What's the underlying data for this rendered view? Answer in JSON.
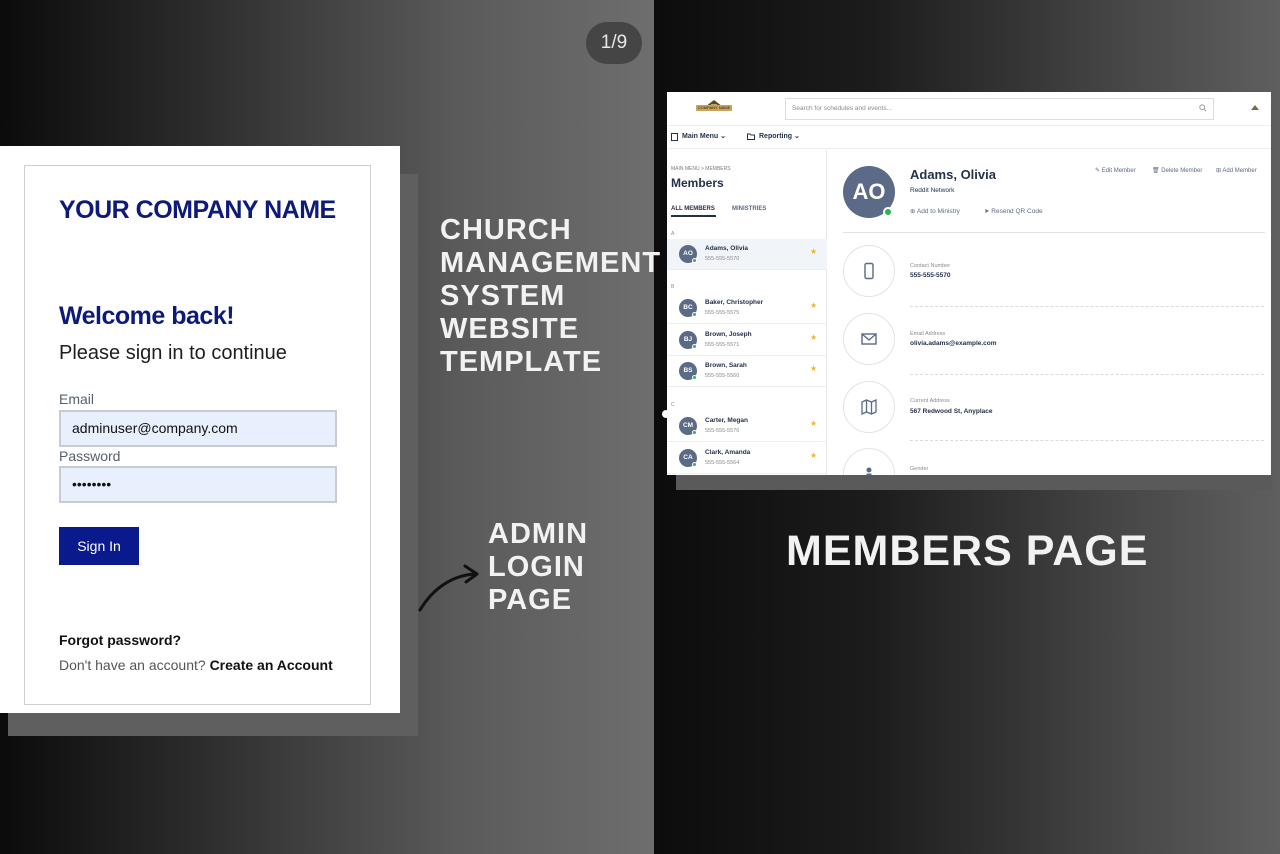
{
  "page_counter": "1/9",
  "login": {
    "company_name": "YOUR COMPANY NAME",
    "welcome": "Welcome back!",
    "subtitle": "Please sign in to continue",
    "email_label": "Email",
    "email_value": "adminuser@company.com",
    "password_label": "Password",
    "password_value": "••••••••",
    "signin_label": "Sign In",
    "forgot_label": "Forgot password?",
    "no_account_text": "Don't have an account?",
    "create_account_label": "Create an Account"
  },
  "captions": {
    "main_title": [
      "CHURCH",
      "MANAGEMENT",
      "SYSTEM",
      "WEBSITE",
      "TEMPLATE"
    ],
    "admin_login": [
      "ADMIN",
      "LOGIN",
      "PAGE"
    ],
    "members_page": "MEMBERS PAGE"
  },
  "members_app": {
    "logo_text": "COMPANY NAME",
    "search_placeholder": "Search for schedules and events...",
    "nav": {
      "main_menu": "Main Menu",
      "reporting": "Reporting"
    },
    "breadcrumb": "MAIN MENU  >  MEMBERS",
    "title": "Members",
    "tabs": [
      "ALL MEMBERS",
      "MINISTRIES"
    ],
    "groups": [
      {
        "letter": "A",
        "members": [
          {
            "initials": "AO",
            "name": "Adams, Olivia",
            "phone": "555-555-5570",
            "selected": true
          }
        ]
      },
      {
        "letter": "B",
        "members": [
          {
            "initials": "BC",
            "name": "Baker, Christopher",
            "phone": "555-555-5575"
          },
          {
            "initials": "BJ",
            "name": "Brown, Joseph",
            "phone": "555-555-5571"
          },
          {
            "initials": "BS",
            "name": "Brown, Sarah",
            "phone": "555-555-5560"
          }
        ]
      },
      {
        "letter": "C",
        "members": [
          {
            "initials": "CM",
            "name": "Carter, Megan",
            "phone": "555-555-5576"
          },
          {
            "initials": "CA",
            "name": "Clark, Amanda",
            "phone": "555-555-5564"
          }
        ]
      }
    ],
    "profile": {
      "initials": "AO",
      "name": "Adams, Olivia",
      "network": "Reddit Network",
      "add_to_ministry": "Add to Ministry",
      "resend_qr": "Resend QR Code",
      "edit_member": "Edit Member",
      "delete_member": "Delete Member",
      "add_member": "Add Member",
      "contact_label": "Contact Number",
      "contact_value": "555-555-5570",
      "email_label": "Email Address",
      "email_value": "olivia.adams@example.com",
      "address_label": "Current Address",
      "address_value": "567 Redwood St, Anyplace",
      "gender_label": "Gender"
    }
  },
  "colors": {
    "brand_navy": "#0d1a7a",
    "button_navy": "#0a1a8c",
    "avatar_slate": "#5b6a86",
    "online_green": "#30b34a",
    "star_gold": "#f0b429"
  }
}
